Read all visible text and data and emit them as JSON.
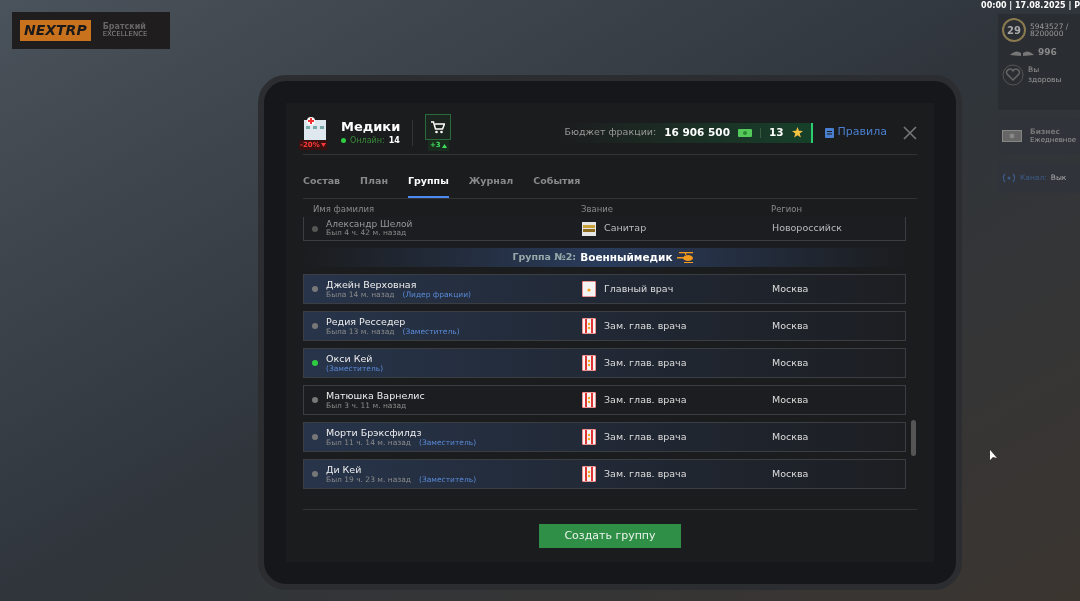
{
  "hud": {
    "logo": "NEXTRP",
    "server": "Братский",
    "server_sub": "EXCELLENCE",
    "clock": "00:00 | 17.08.2025 | Р",
    "level": "29",
    "xp": "5943527 /",
    "xp_max": "8200000",
    "wings": "996",
    "health_1": "Вы",
    "health_2": "здоровы",
    "business": "Бизнес",
    "business_sub": "Ежедневное",
    "channel_label": "Канал:",
    "channel_value": "Вык"
  },
  "faction": {
    "name": "Медики",
    "discount": "-20%",
    "online_label": "Онлайн:",
    "online": "14",
    "cart_badge": "+3",
    "budget_label": "Бюджет фракции:",
    "budget": "16 906 500",
    "stars": "13",
    "rules": "Правила"
  },
  "tabs": [
    {
      "label": "Состав",
      "selected": false
    },
    {
      "label": "План",
      "selected": false
    },
    {
      "label": "Группы",
      "selected": true
    },
    {
      "label": "Журнал",
      "selected": false
    },
    {
      "label": "События",
      "selected": false
    }
  ],
  "columns": [
    "Имя фамилия",
    "Звание",
    "Регион"
  ],
  "previous_row": {
    "name": "Александр Шелой",
    "last_seen": "Был 4 ч. 42 м. назад",
    "rank": "Санитар",
    "rank_icon": {
      "kind": "sanitar"
    },
    "region": "Новороссийск"
  },
  "group": {
    "label": "Группа №2:",
    "name": "Военныймедик"
  },
  "members": [
    {
      "name": "Джейн Верховная",
      "online": false,
      "highlighted": true,
      "last_seen": "Была 14 м. назад",
      "role": "(Лидер фракции)",
      "rank": "Главный врач",
      "rank_icon": {
        "kind": "chief"
      },
      "region": "Москва"
    },
    {
      "name": "Редия Ресседер",
      "online": false,
      "highlighted": true,
      "last_seen": "Была 13 м. назад",
      "role": "(Заместитель)",
      "rank": "Зам. глав. врача",
      "rank_icon": {
        "kind": "deputy"
      },
      "region": "Москва"
    },
    {
      "name": "Окси Кей",
      "online": true,
      "highlighted": true,
      "role": "(Заместитель)",
      "rank": "Зам. глав. врача",
      "rank_icon": {
        "kind": "deputy"
      },
      "region": "Москва"
    },
    {
      "name": "Матюшка Варнелис",
      "online": false,
      "highlighted": false,
      "last_seen": "Был 3 ч. 11 м. назад",
      "rank": "Зам. глав. врача",
      "rank_icon": {
        "kind": "deputy"
      },
      "region": "Москва"
    },
    {
      "name": "Морти Брэксфилдз",
      "online": false,
      "highlighted": true,
      "last_seen": "Был 11 ч. 14 м. назад",
      "role": "(Заместитель)",
      "rank": "Зам. глав. врача",
      "rank_icon": {
        "kind": "deputy"
      },
      "region": "Москва"
    },
    {
      "name": "Ди Кей",
      "online": false,
      "highlighted": true,
      "last_seen": "Был 19 ч. 23 м. назад",
      "role": "(Заместитель)",
      "rank": "Зам. глав. врача",
      "rank_icon": {
        "kind": "deputy"
      },
      "region": "Москва"
    }
  ],
  "create_button": "Создать группу"
}
